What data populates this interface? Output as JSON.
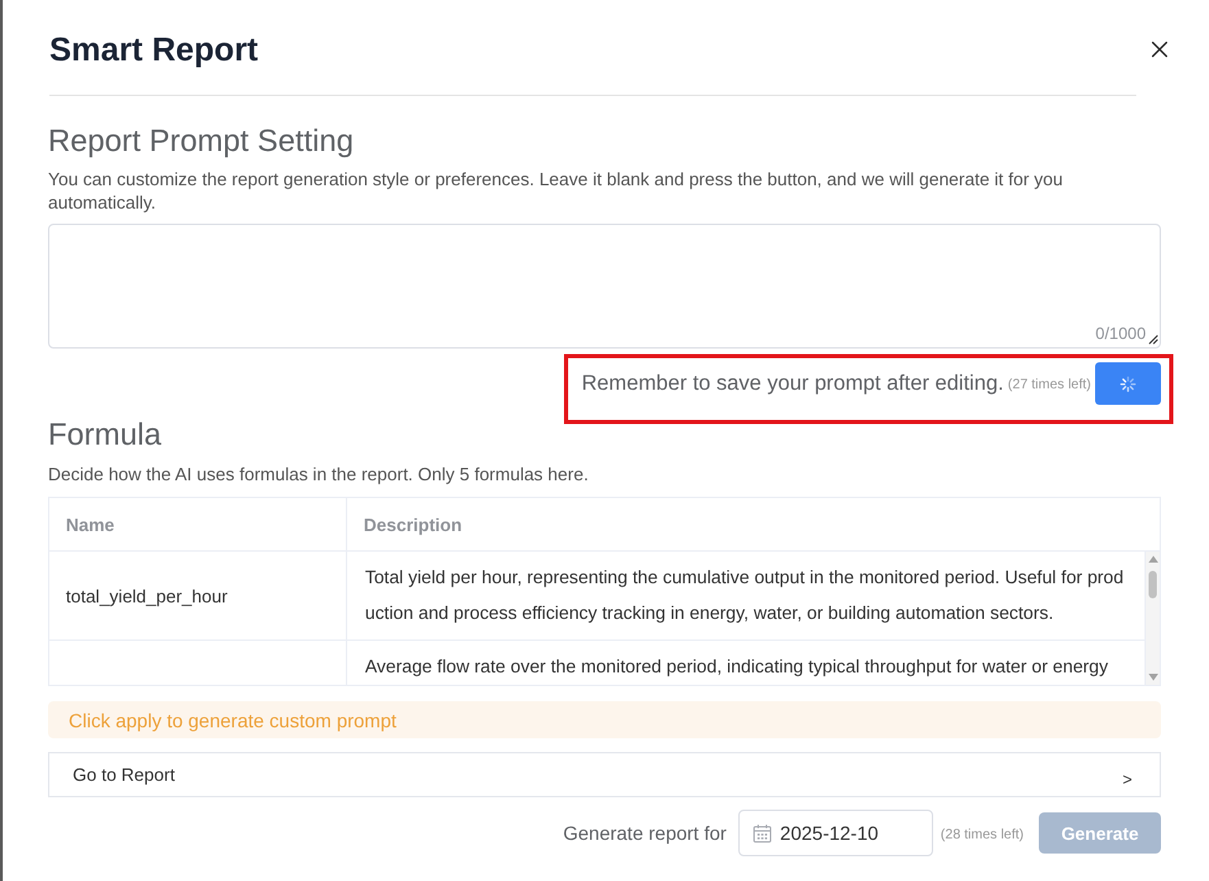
{
  "dialog": {
    "title": "Smart Report"
  },
  "prompt_setting": {
    "heading": "Report Prompt Setting",
    "description": "You can customize the report generation style or preferences. Leave it blank and press the button, and we will generate it for you automatically.",
    "counter": "0/1000"
  },
  "save_prompt": {
    "highlighted": true,
    "hint": "Remember to save your prompt after editing.",
    "times_left": "(27 times left)",
    "button": {
      "loading": true
    }
  },
  "formula": {
    "heading": "Formula",
    "description": "Decide how the AI uses formulas in the report. Only 5 formulas here.",
    "table": {
      "columns": [
        "Name",
        "Description"
      ],
      "rows": [
        {
          "name": "total_yield_per_hour",
          "description": "Total yield per hour, representing the cumulative output in the monitored period. Useful for production and process efficiency tracking in energy, water, or building automation sectors."
        },
        {
          "description": "Average flow rate over the monitored period, indicating typical throughput for water or energy"
        }
      ]
    }
  },
  "alert": {
    "text": "Click apply to generate custom prompt"
  },
  "go_to_report": {
    "label": "Go to Report",
    "chevron": ">"
  },
  "generate": {
    "label": "Generate report for",
    "date": "2025-12-10",
    "times_left": "(28 times left)",
    "button": {
      "label": "Generate",
      "disabled": true
    }
  }
}
